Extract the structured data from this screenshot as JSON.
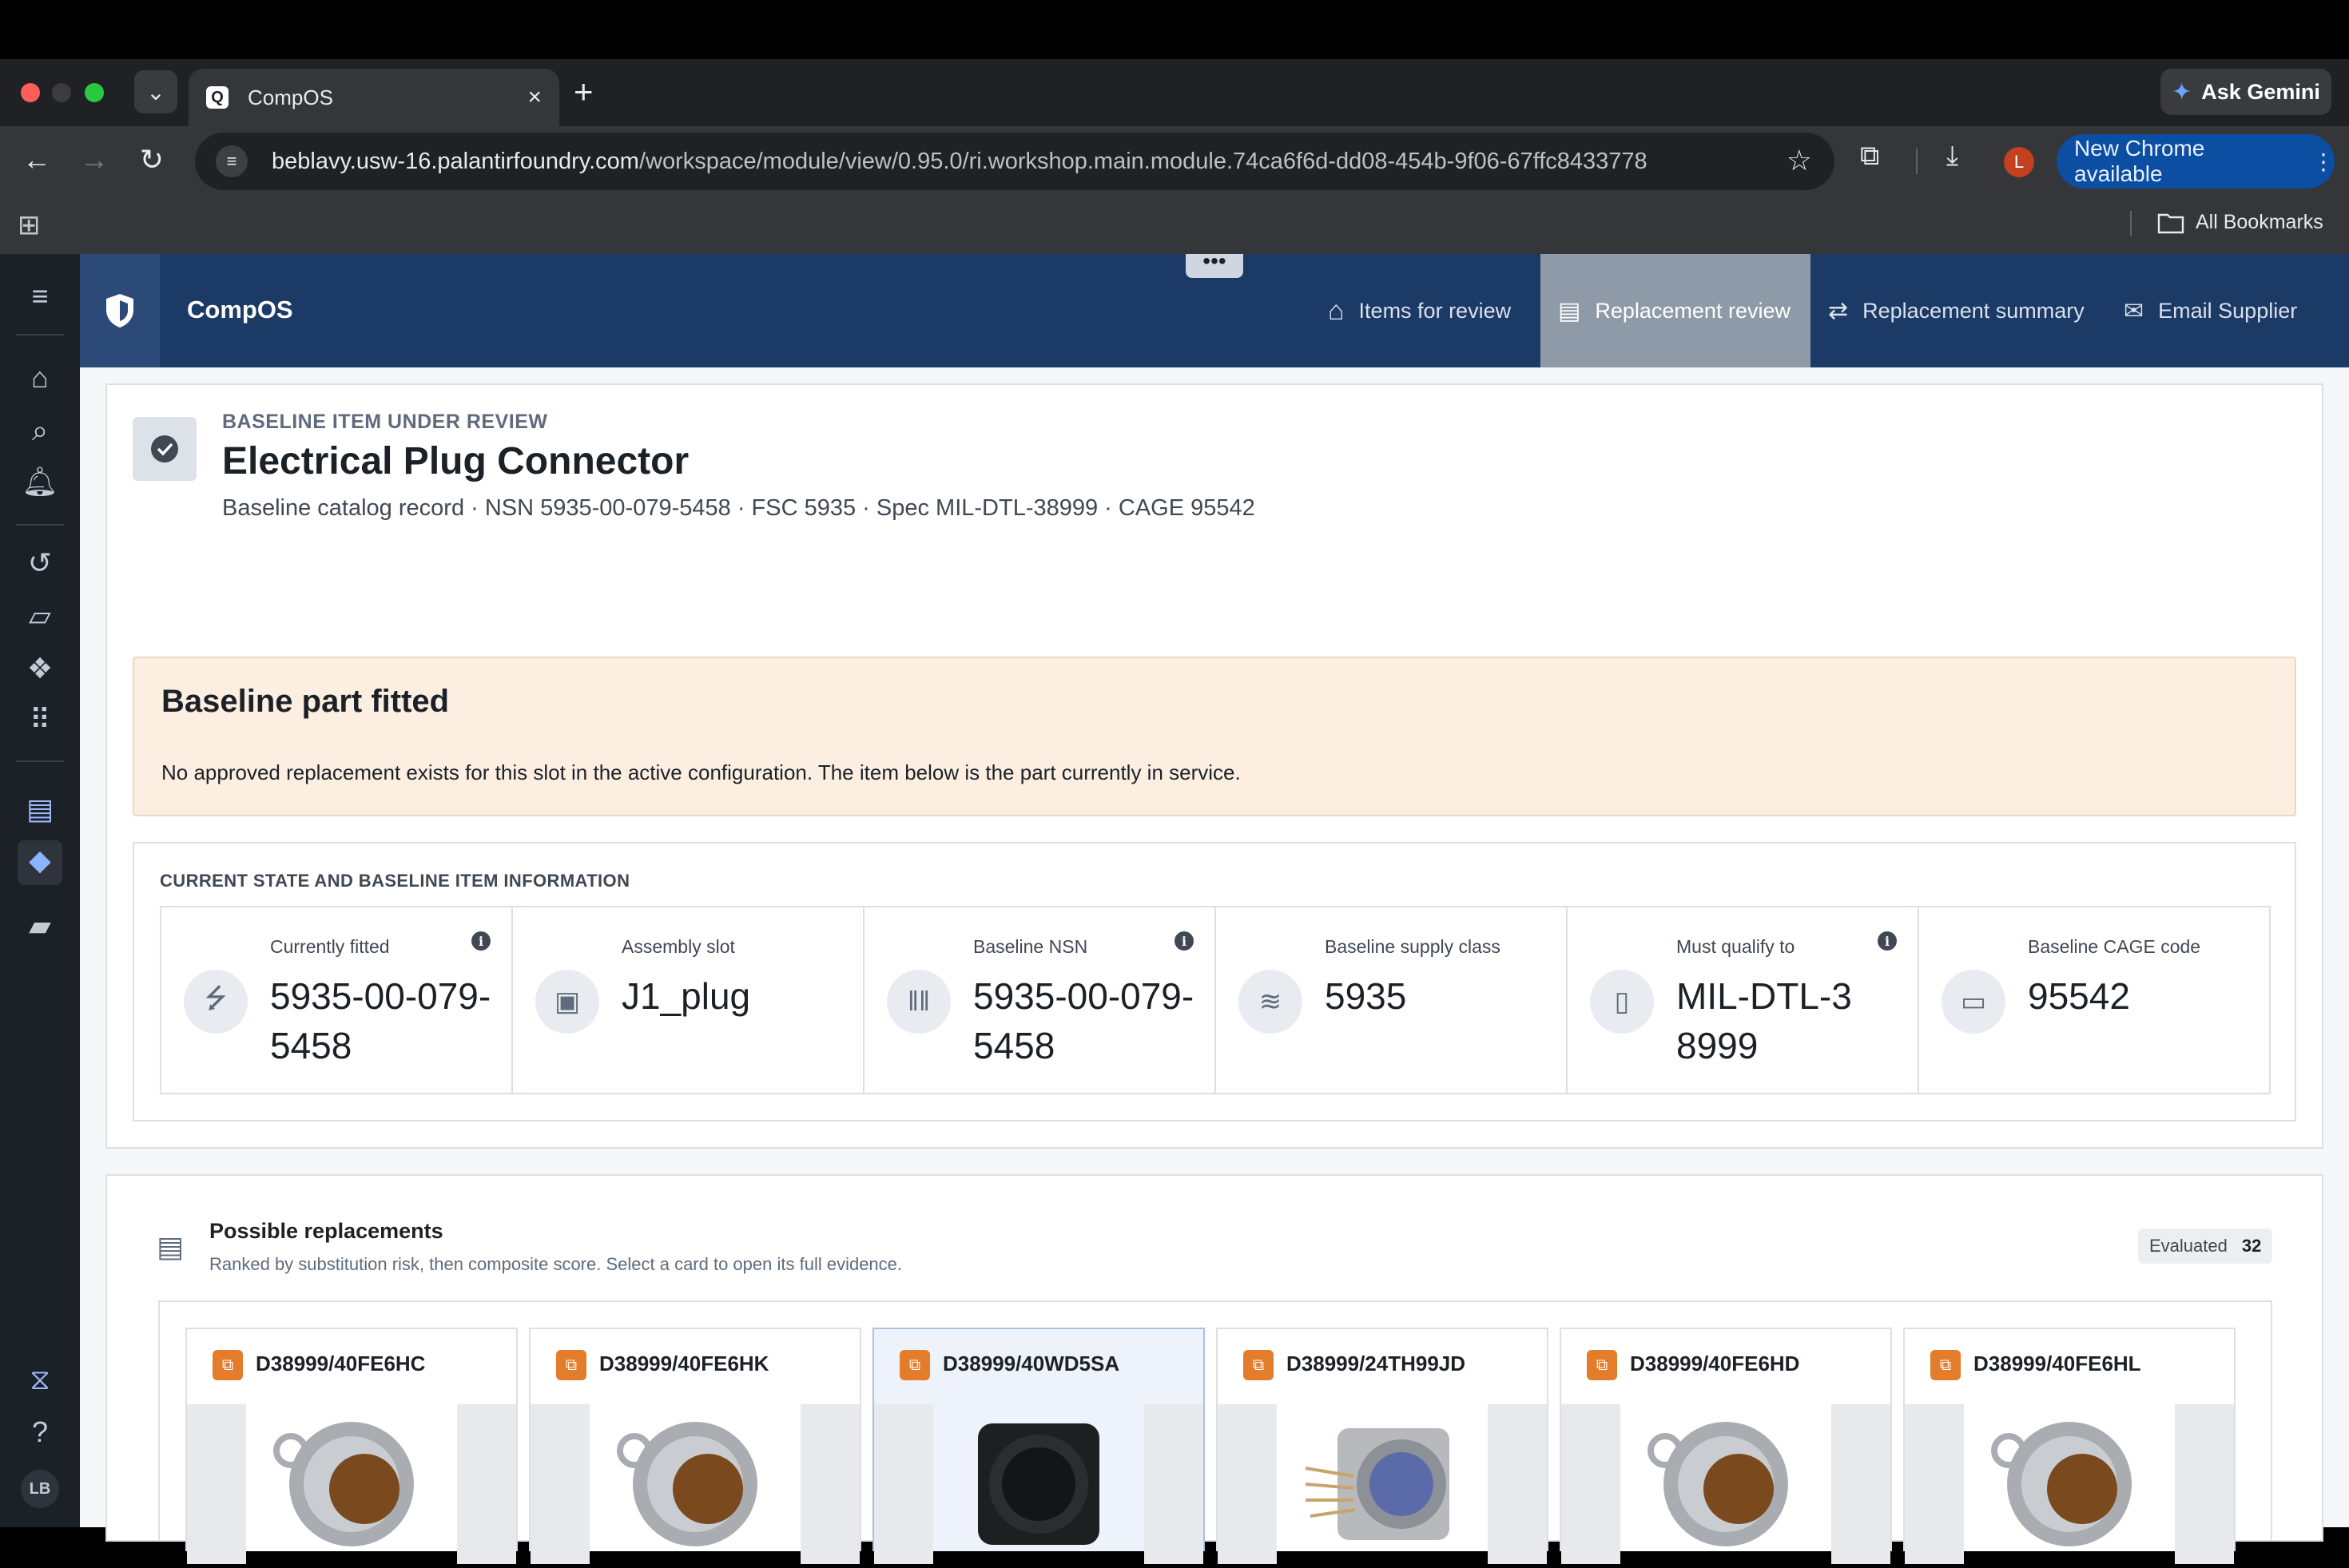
{
  "browser": {
    "tab_title": "CompOS",
    "tab_favicon": "Q",
    "url_host": "beblavy.usw-16.palantirfoundry.com",
    "url_path": "/workspace/module/view/0.95.0/ri.workshop.main.module.74ca6f6d-dd08-454b-9f06-67ffc8433778",
    "gemini_label": "Ask Gemini",
    "update_label": "New Chrome available",
    "profile_initial": "L",
    "all_bookmarks": "All Bookmarks"
  },
  "rail": {
    "user_initials": "LB"
  },
  "app": {
    "name": "CompOS",
    "nav": [
      {
        "label": "Items for review",
        "icon": "home-icon",
        "active": false
      },
      {
        "label": "Replacement review",
        "icon": "compare-icon",
        "active": true
      },
      {
        "label": "Replacement summary",
        "icon": "swap-icon",
        "active": false
      },
      {
        "label": "Email Supplier",
        "icon": "envelope-icon",
        "active": false
      }
    ]
  },
  "header": {
    "eyebrow": "BASELINE ITEM UNDER REVIEW",
    "title": "Electrical Plug Connector",
    "subtitle": "Baseline catalog record · NSN 5935-00-079-5458 · FSC 5935 · Spec MIL-DTL-38999 · CAGE 95542"
  },
  "callout": {
    "title": "Baseline part fitted",
    "text": "No approved replacement exists for this slot in the active configuration. The item below is the part currently in service."
  },
  "baseline_info": {
    "section_label": "CURRENT STATE AND BASELINE ITEM INFORMATION",
    "kpis": [
      {
        "label": "Currently fitted",
        "value": "5935-00-079-5458",
        "icon": "usb-icon",
        "info": true
      },
      {
        "label": "Assembly slot",
        "value": "J1_plug",
        "icon": "cube-icon",
        "info": false
      },
      {
        "label": "Baseline NSN",
        "value": "5935-00-079-5458",
        "icon": "barcode-icon",
        "info": true
      },
      {
        "label": "Baseline supply class",
        "value": "5935",
        "icon": "layers-icon",
        "info": false
      },
      {
        "label": "Must qualify to",
        "value": "MIL-DTL-38999",
        "icon": "document-icon",
        "info": true
      },
      {
        "label": "Baseline CAGE code",
        "value": "95542",
        "icon": "id-card-icon",
        "info": false
      }
    ]
  },
  "replacements": {
    "title": "Possible replacements",
    "subtitle": "Ranked by substitution risk, then composite score. Select a card to open its full evidence.",
    "evaluated_label": "Evaluated",
    "evaluated_count": "32",
    "cards": [
      {
        "name": "D38999/40FE6HC",
        "image": "circular-connector-with-strap",
        "selected": false
      },
      {
        "name": "D38999/40FE6HK",
        "image": "circular-connector-with-strap",
        "selected": false
      },
      {
        "name": "D38999/40WD5SA",
        "image": "black-flange-receptacle",
        "selected": true
      },
      {
        "name": "D38999/24TH99JD",
        "image": "pin-receptacle",
        "selected": false
      },
      {
        "name": "D38999/40FE6HD",
        "image": "circular-connector-with-strap",
        "selected": false
      },
      {
        "name": "D38999/40FE6HL",
        "image": "circular-connector-with-strap",
        "selected": false
      }
    ]
  },
  "colors": {
    "app_header": "#1c3a66",
    "active_tab": "#8f9aa8",
    "callout_bg": "#fcefe2",
    "part_badge": "#e37d2b",
    "selected_card": "#eef3fb"
  }
}
